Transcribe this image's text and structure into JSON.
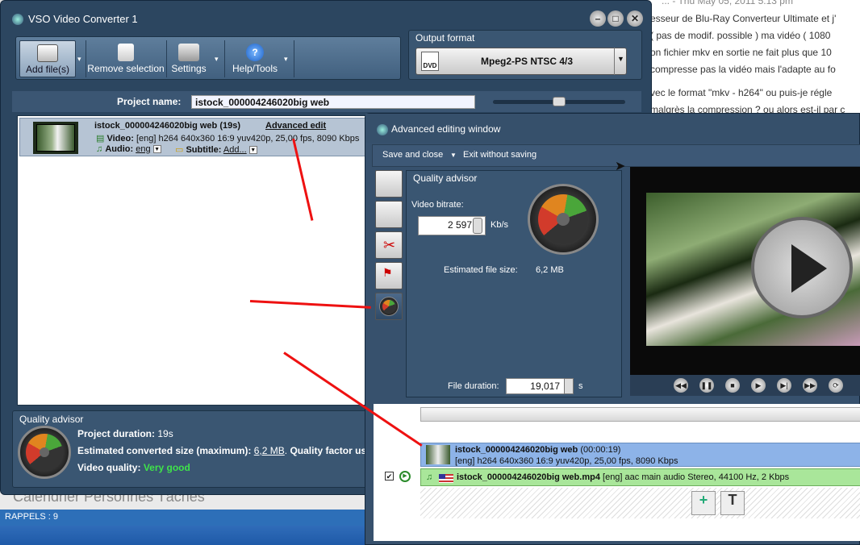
{
  "bg_page": {
    "lines": [
      "... - Thu May 05, 2011 5:13 pm",
      "esseur de Blu-Ray Converteur Ultimate et j'",
      "( pas de modif. possible ) ma vidéo ( 1080",
      "on fichier mkv en sortie ne fait plus que 10",
      "compresse pas la vidéo mais l'adapte au fo",
      "vec le format \"mkv - h264\" ou puis-je régle",
      "malgrès la compression ? ou alors est-il par c"
    ],
    "calendar_tabs": "Calendrier   Personnes   Tâches",
    "rappels": "RAPPELS : 9"
  },
  "main": {
    "title": "VSO Video Converter 1",
    "toolbar": {
      "add": "Add file(s)",
      "remove": "Remove selection",
      "settings": "Settings",
      "help": "Help/Tools"
    },
    "output_format": {
      "label": "Output format",
      "value": "Mpeg2-PS NTSC 4/3",
      "icon_text": "DVD"
    },
    "project": {
      "label": "Project name:",
      "value": "istock_000004246020big web"
    },
    "file": {
      "name": "istock_000004246020big web (19s)",
      "adv_link": "Advanced edit",
      "video_label": "Video:",
      "video_info": "[eng] h264 640x360 16:9 yuv420p, 25,00 fps, 8090 Kbps",
      "audio_label": "Audio:",
      "audio_value": "eng",
      "subtitle_label": "Subtitle:",
      "subtitle_value": "Add..."
    },
    "quality": {
      "label": "Quality advisor",
      "duration_label": "Project duration:",
      "duration_value": "19s",
      "size_label": "Estimated converted size (maximum):",
      "size_value": "6,2 MB",
      "factor_label": "Quality factor us",
      "vq_label": "Video quality:",
      "vq_value": "Very good"
    }
  },
  "adv": {
    "title": "Advanced editing window",
    "menu": {
      "save": "Save and close",
      "exit": "Exit without saving"
    },
    "qa_label": "Quality advisor",
    "bitrate_label": "Video bitrate:",
    "bitrate_value": "2 597",
    "bitrate_unit": "Kb/s",
    "est_label": "Estimated file size:",
    "est_value": "6,2 MB",
    "duration_label": "File duration:",
    "duration_value": "19,017",
    "duration_unit": "s",
    "video_track": {
      "name": "istock_000004246020big web",
      "dur": "(00:00:19)",
      "info": "[eng] h264 640x360 16:9 yuv420p, 25,00 fps, 8090 Kbps"
    },
    "audio_track": {
      "name": "istock_000004246020big web.mp4",
      "info": "[eng] aac main audio Stereo, 44100 Hz, 2 Kbps"
    },
    "add_audio_icon_text": "+",
    "add_text_icon_text": "T"
  },
  "colors": {
    "accent_red": "#ee1111",
    "very_good": "#3fe34a",
    "window_bg": "#2c4660"
  }
}
